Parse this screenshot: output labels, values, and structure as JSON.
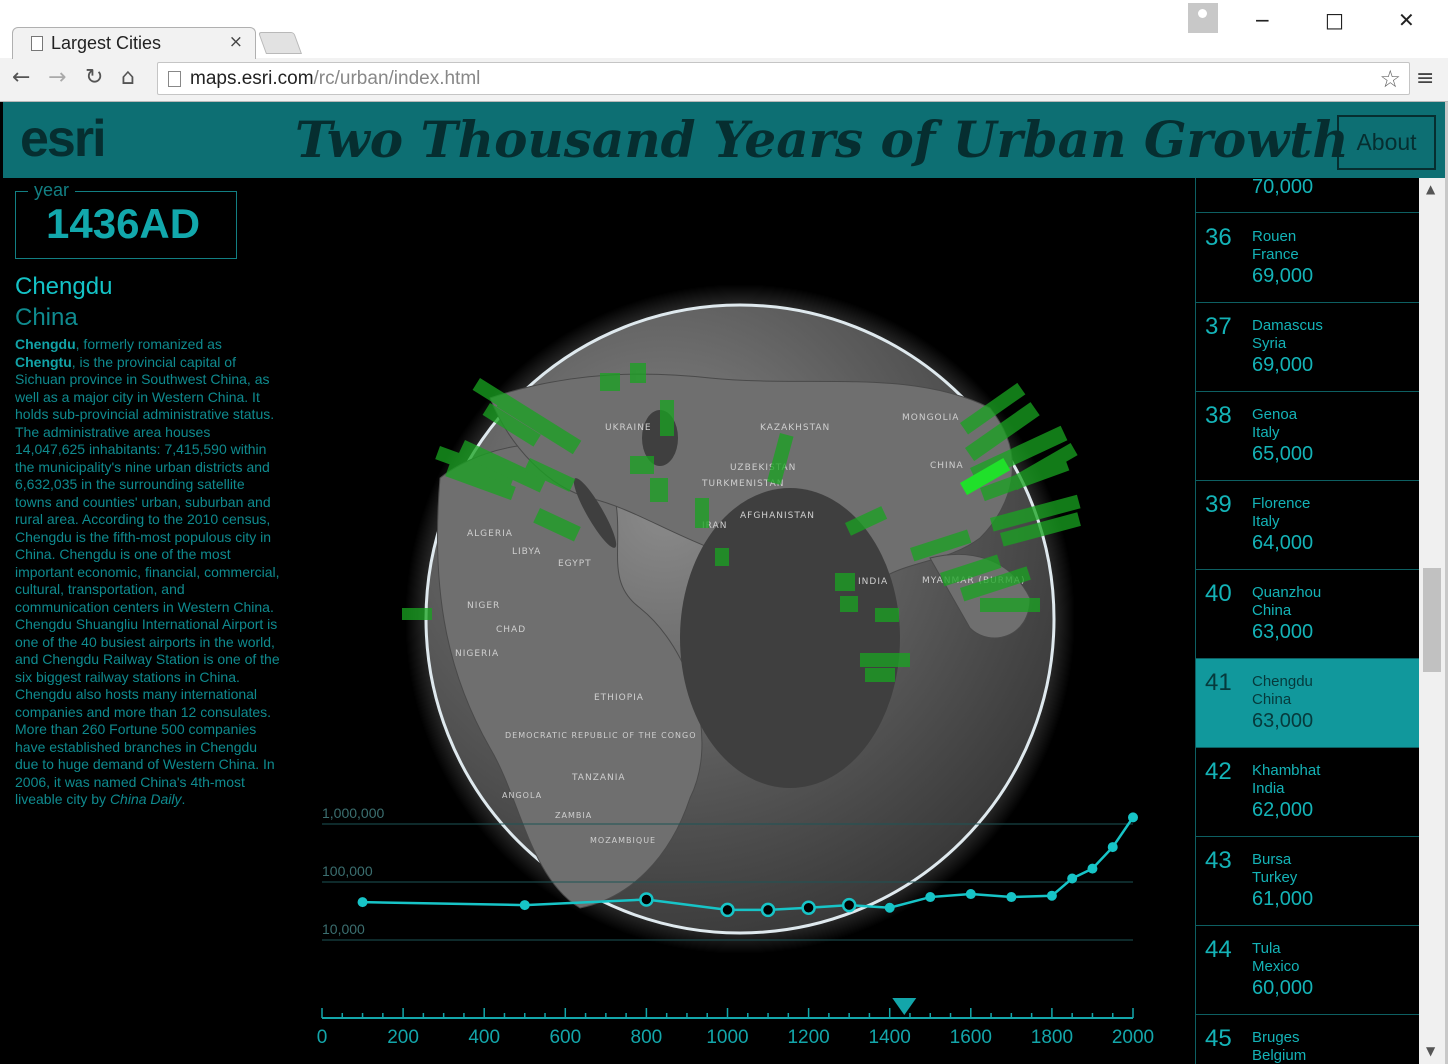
{
  "browser": {
    "tab_title": "Largest Cities",
    "tab_close": "×",
    "url_host": "maps.esri.com",
    "url_path": "/rc/urban/index.html",
    "window_controls": [
      "−",
      "□",
      "✕"
    ]
  },
  "header": {
    "logo": "esri",
    "title": "Two Thousand Years of Urban Growth",
    "about_label": "About",
    "color": "#0d6f73"
  },
  "year_panel": {
    "label": "year",
    "value": "1436AD"
  },
  "city": {
    "name": "Chengdu",
    "country": "China",
    "desc_bold_1": "Chengdu",
    "desc_1": ", formerly romanized as ",
    "desc_bold_2": "Chengtu",
    "desc_2": ", is the provincial capital of Sichuan province in Southwest China, as well as a major city in Western China. It holds sub-provincial administrative status. The administrative area houses 14,047,625 inhabitants: 7,415,590 within the municipality's nine urban districts and 6,632,035 in the surrounding satellite towns and counties' urban, suburban and rural area. According to the 2010 census, Chengdu is the fifth-most populous city in China. Chengdu is one of the most important economic, financial, commercial, cultural, transportation, and communication centers in Western China. Chengdu Shuangliu International Airport is one of the 40 busiest airports in the world, and Chengdu Railway Station is one of the six biggest railway stations in China. Chengdu also hosts many international companies and more than 12 consulates. More than 260 Fortune 500 companies have established branches in Chengdu due to huge demand of Western China. In 2006, it was named China's 4th-most liveable city by ",
    "desc_italic": "China Daily",
    "desc_end": "."
  },
  "map_labels": [
    "UKRAINE",
    "KAZAKHSTAN",
    "MONGOLIA",
    "UZBEKISTAN",
    "TURKMENISTAN",
    "AFGHANISTAN",
    "IRAN",
    "CHINA",
    "INDIA",
    "MYANMAR (BURMA)",
    "LIBYA",
    "EGYPT",
    "ALGERIA",
    "NIGER",
    "CHAD",
    "NIGERIA",
    "ETHIOPIA",
    "DEMOCRATIC REPUBLIC OF THE CONGO",
    "TANZANIA",
    "ANGOLA",
    "ZAMBIA",
    "MOZAMBIQUE"
  ],
  "ranking": {
    "top_value": "70,000",
    "items": [
      {
        "rank": "36",
        "city": "Rouen",
        "country": "France",
        "pop": "69,000"
      },
      {
        "rank": "37",
        "city": "Damascus",
        "country": "Syria",
        "pop": "69,000"
      },
      {
        "rank": "38",
        "city": "Genoa",
        "country": "Italy",
        "pop": "65,000"
      },
      {
        "rank": "39",
        "city": "Florence",
        "country": "Italy",
        "pop": "64,000"
      },
      {
        "rank": "40",
        "city": "Quanzhou",
        "country": "China",
        "pop": "63,000"
      },
      {
        "rank": "41",
        "city": "Chengdu",
        "country": "China",
        "pop": "63,000",
        "active": true
      },
      {
        "rank": "42",
        "city": "Khambhat",
        "country": "India",
        "pop": "62,000"
      },
      {
        "rank": "43",
        "city": "Bursa",
        "country": "Turkey",
        "pop": "61,000"
      },
      {
        "rank": "44",
        "city": "Tula",
        "country": "Mexico",
        "pop": "60,000"
      },
      {
        "rank": "45",
        "city": "Bruges",
        "country": "Belgium",
        "pop": ""
      }
    ]
  },
  "chart_data": {
    "type": "line",
    "y_scale": "log",
    "ylim": [
      10000,
      1000000
    ],
    "y_ticks": [
      "1,000,000",
      "100,000",
      "10,000"
    ],
    "y_tick_values": [
      1000000,
      100000,
      10000
    ],
    "xlim": [
      0,
      2000
    ],
    "x_ticks": [
      "0",
      "200",
      "400",
      "600",
      "800",
      "1000",
      "1200",
      "1400",
      "1600",
      "1800",
      "2000"
    ],
    "x": [
      100,
      500,
      800,
      1000,
      1100,
      1200,
      1300,
      1400,
      1500,
      1600,
      1700,
      1800,
      1850,
      1900,
      1950,
      2000
    ],
    "y": [
      45000,
      40000,
      50000,
      33000,
      33000,
      36000,
      40000,
      36000,
      55000,
      62000,
      55000,
      58000,
      115000,
      170000,
      400000,
      1300000
    ],
    "highlighted_x": [
      800,
      1000,
      1100,
      1200,
      1300
    ],
    "current_year": 1436,
    "line_color": "#17c4c7"
  }
}
